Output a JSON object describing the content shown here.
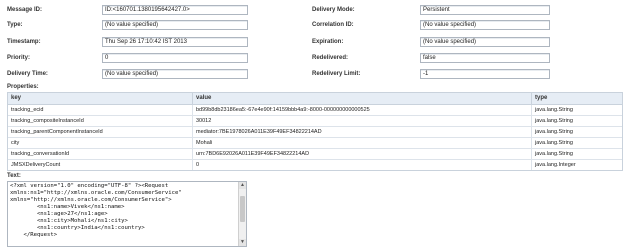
{
  "fields": {
    "message_id": {
      "label": "Message ID:",
      "value": "ID:<160701.1380195642427.0>"
    },
    "type": {
      "label": "Type:",
      "value": "(No value specified)"
    },
    "timestamp": {
      "label": "Timestamp:",
      "value": "Thu Sep 26 17:10:42 IST 2013"
    },
    "priority": {
      "label": "Priority:",
      "value": "0"
    },
    "delivery_time": {
      "label": "Delivery Time:",
      "value": "(No value specified)"
    },
    "delivery_mode": {
      "label": "Delivery Mode:",
      "value": "Persistent"
    },
    "correlation_id": {
      "label": "Correlation ID:",
      "value": "(No value specified)"
    },
    "expiration": {
      "label": "Expiration:",
      "value": "(No value specified)"
    },
    "redelivered": {
      "label": "Redelivered:",
      "value": "false"
    },
    "redelivery_limit": {
      "label": "Redelivery Limit:",
      "value": "-1"
    }
  },
  "properties": {
    "title": "Properties:",
    "columns": [
      "key",
      "value",
      "type"
    ],
    "rows": [
      {
        "key": "tracking_ecid",
        "value": "bd99b8db23186ea5:-67e4e90f:14159bbb4a9:-8000-000000000000525",
        "type": "java.lang.String"
      },
      {
        "key": "tracking_compositeInstanceId",
        "value": "30012",
        "type": "java.lang.String"
      },
      {
        "key": "tracking_parentComponentInstanceId",
        "value": "mediator:7BE1978026A011E39F49EF34822214AD",
        "type": "java.lang.String"
      },
      {
        "key": "city",
        "value": "Mohali",
        "type": "java.lang.String"
      },
      {
        "key": "tracking_conversationId",
        "value": "urn:7BD6E92026A011E39F49EF34822214AD",
        "type": "java.lang.String"
      },
      {
        "key": "JMSXDeliveryCount",
        "value": "0",
        "type": "java.lang.Integer"
      }
    ]
  },
  "text": {
    "title": "Text:",
    "content": "<?xml version=\"1.0\" encoding=\"UTF-8\" ?><Request\nxmlns:ns1=\"http://xmlns.oracle.com/ConsumerService\"\nxmlns=\"http://xmlns.oracle.com/ConsumerService\">\n        <ns1:name>Vivek</ns1:name>\n        <ns1:age>27</ns1:age>\n        <ns1:city>Mohali</ns1:city>\n        <ns1:country>India</ns1:country>\n    </Request>"
  }
}
